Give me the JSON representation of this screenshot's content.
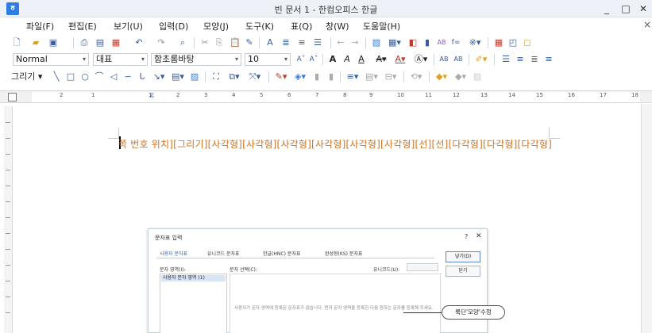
{
  "window": {
    "title": "빈 문서 1 - 한컴오피스 한글",
    "min_label": "_",
    "max_label": "□",
    "close_label": "✕"
  },
  "menu": {
    "items": [
      "파일(F)",
      "편집(E)",
      "보기(U)",
      "입력(D)",
      "모양(J)",
      "도구(K)",
      "표(Q)",
      "창(W)",
      "도움말(H)"
    ],
    "close_label": "×"
  },
  "format_bar": {
    "style": "Normal",
    "font_group": "대표",
    "font_name": "함초롬바탕",
    "font_size": "10"
  },
  "draw_bar": {
    "label": "그리기"
  },
  "ruler": {
    "numbers": [
      "2",
      "1",
      "1",
      "2",
      "3",
      "4",
      "5",
      "6",
      "7",
      "8",
      "9",
      "10",
      "11",
      "12",
      "13",
      "14",
      "15",
      "16",
      "17",
      "18"
    ]
  },
  "document": {
    "text": "쪽 번호 위치][그리기][사각형][사각형][사각형][사각형][사각형][사각형][선][선][다각형][다각형][다각형]"
  },
  "dialog": {
    "title": "문자표 입력",
    "help_label": "?",
    "close_label": "✕",
    "tabs": [
      "사용자 문자표",
      "유니코드 문자표",
      "한글(HNC) 문자표",
      "완성형(KS) 문자표"
    ],
    "area_label": "문자 영역(I):",
    "select_label": "문자 선택(C):",
    "unicode_label": "유니코드(U):",
    "area_items": [
      "사용자 문자 영역 (1)"
    ],
    "empty_message": "사용자가 문자 영역에 등록된 문자표가 없습니다. 먼저 문자 영역을 등록한 다음 원하는 문자를 등록해 주세요.",
    "insert_button": "넣기(D)",
    "close_button": "닫기"
  },
  "tooltip": {
    "text": "룩단'모양'수정"
  }
}
